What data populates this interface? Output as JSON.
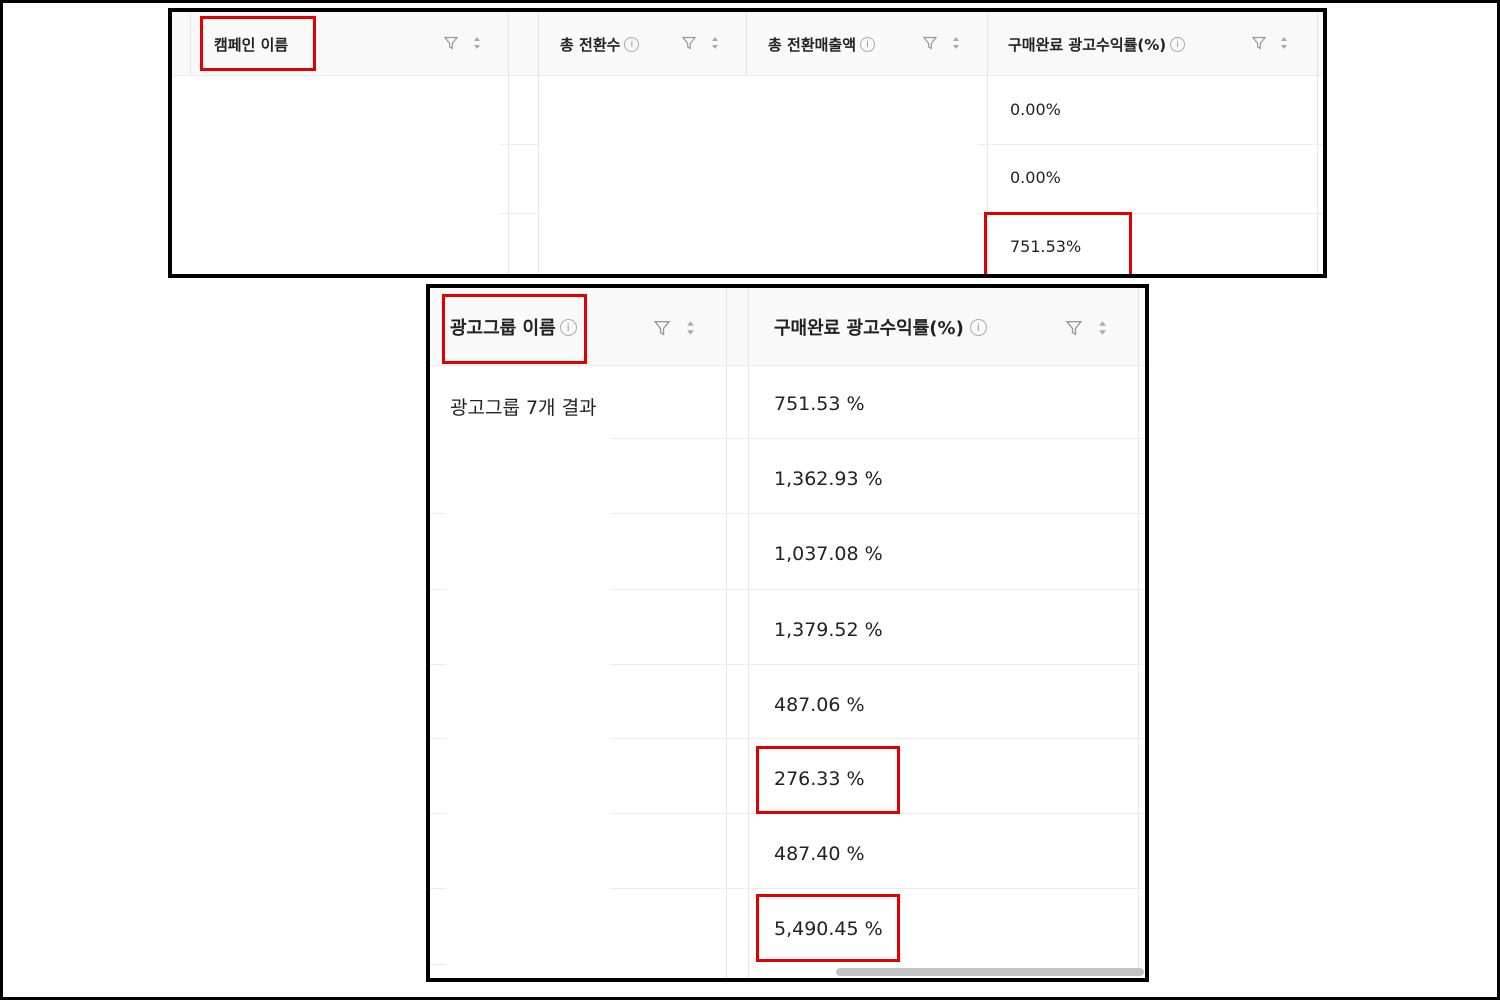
{
  "top_table": {
    "headers": {
      "campaign_name": "캠페인 이름",
      "total_conversions": "총 전환수",
      "total_conversion_revenue": "총 전환매출액",
      "purchase_roas": "구매완료 광고수익률(%)"
    },
    "roas_values": [
      "0.00%",
      "0.00%",
      "751.53%"
    ]
  },
  "bottom_table": {
    "headers": {
      "adgroup_name": "광고그룹 이름",
      "purchase_roas": "구매완료 광고수익률(%)"
    },
    "summary": "광고그룹 7개 결과",
    "roas_values": [
      "751.53 %",
      "1,362.93 %",
      "1,037.08 %",
      "1,379.52 %",
      "487.06 %",
      "276.33 %",
      "487.40 %",
      "5,490.45 %"
    ]
  },
  "icons": {
    "filter": "filter-icon",
    "sort": "sort-icon",
    "info": "info-icon",
    "info_glyph": "i"
  },
  "colors": {
    "highlight": "#e00000",
    "border": "#000000",
    "header_bg": "#f9f9f9"
  }
}
